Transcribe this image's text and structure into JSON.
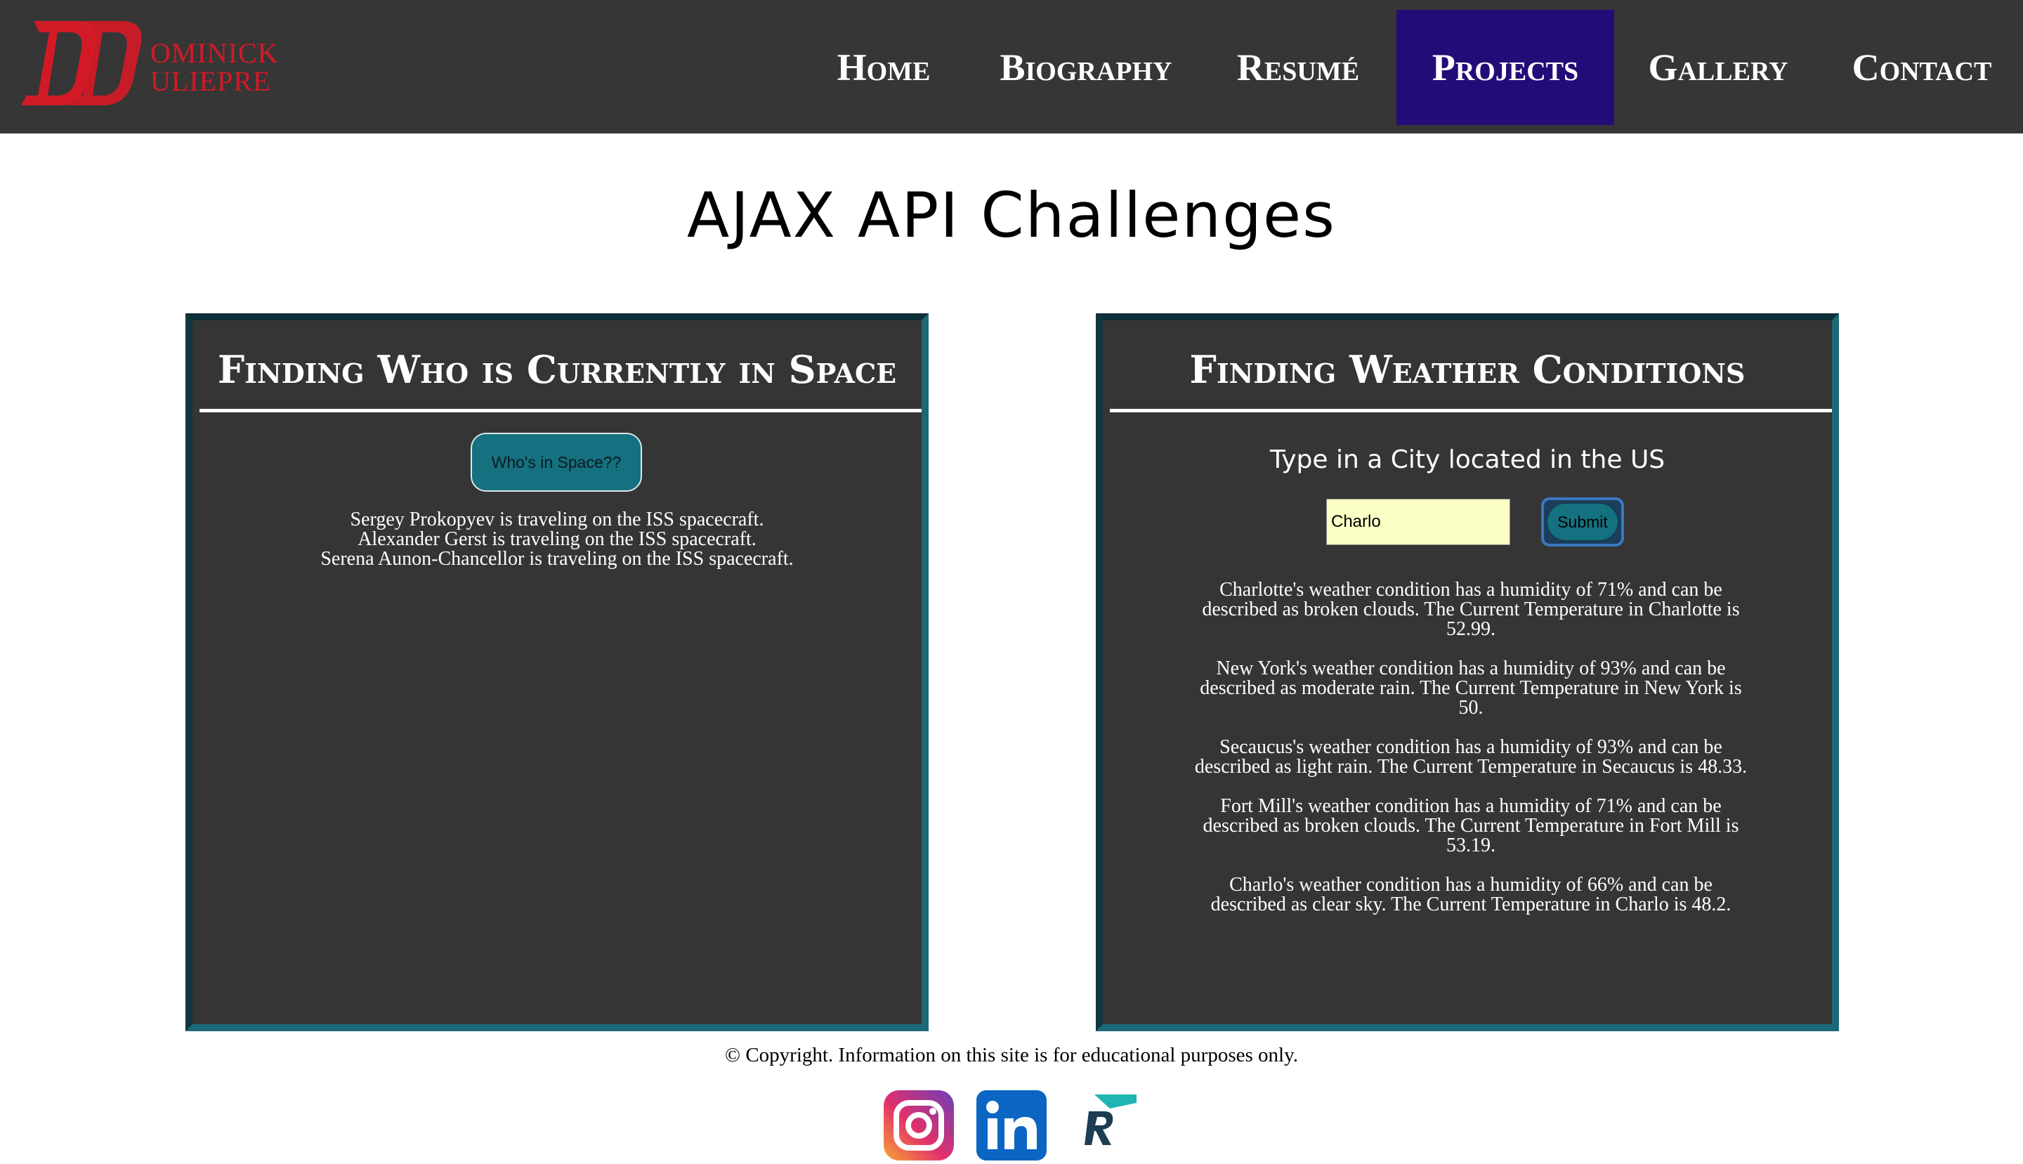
{
  "header": {
    "logo": {
      "monogram": "DD",
      "name_line1": "OMINICK",
      "name_line2": "ULIEPRE",
      "color": "#d21a26"
    },
    "nav": [
      {
        "label": "Home"
      },
      {
        "label": "Biography"
      },
      {
        "label": "Resumé"
      },
      {
        "label": "Projects",
        "active": true
      },
      {
        "label": "Gallery"
      },
      {
        "label": "Contact"
      }
    ],
    "active_color": "#240c78"
  },
  "page": {
    "title": "AJAX API Challenges"
  },
  "space_panel": {
    "title": "Finding Who is Currently in Space",
    "button_label": "Who's in Space??",
    "astronauts": [
      "Sergey Prokopyev is traveling on the ISS spacecraft.",
      "Alexander Gerst is traveling on the ISS spacecraft.",
      "Serena Aunon-Chancellor is traveling on the ISS spacecraft."
    ]
  },
  "weather_panel": {
    "title": "Finding Weather Conditions",
    "prompt": "Type in a City located in the US",
    "city_input_value": "Charlo",
    "submit_label": "Submit",
    "results": [
      "Charlotte's weather condition has a humidity of 71% and can be described as broken clouds. The Current Temperature in Charlotte is 52.99.",
      "New York's weather condition has a humidity of 93% and can be described as moderate rain. The Current Temperature in New York is 50.",
      "Secaucus's weather condition has a humidity of 93% and can be described as light rain. The Current Temperature in Secaucus is 48.33.",
      "Fort Mill's weather condition has a humidity of 71% and can be described as broken clouds. The Current Temperature in Fort Mill is 53.19.",
      "Charlo's weather condition has a humidity of 66% and can be described as clear sky. The Current Temperature in Charlo is 48.2."
    ]
  },
  "footer": {
    "copyright": "© Copyright. Information on this site is for educational purposes only.",
    "social_icons": [
      "instagram-icon",
      "linkedin-icon",
      "resume-logo-icon"
    ]
  },
  "colors": {
    "topbar": "#363636",
    "panel_bg": "#353535",
    "panel_border": "#1c6877",
    "button_teal": "#15707f",
    "input_bg": "#fbffc6"
  }
}
